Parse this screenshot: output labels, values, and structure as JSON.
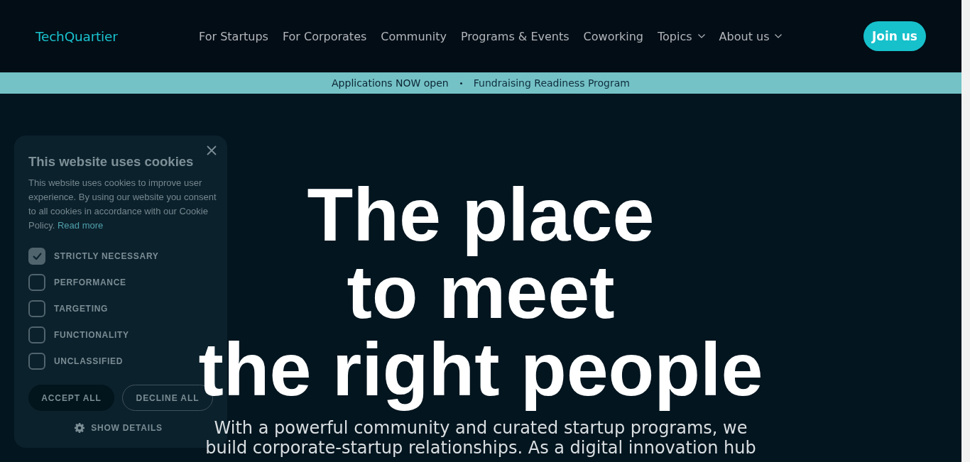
{
  "header": {
    "logo": "TechQuartier",
    "nav": [
      {
        "label": "For Startups",
        "dropdown": false
      },
      {
        "label": "For Corporates",
        "dropdown": false
      },
      {
        "label": "Community",
        "dropdown": false
      },
      {
        "label": "Programs & Events",
        "dropdown": false
      },
      {
        "label": "Coworking",
        "dropdown": false
      },
      {
        "label": "Topics",
        "dropdown": true
      },
      {
        "label": "About us",
        "dropdown": true
      }
    ],
    "cta": "Join us"
  },
  "announcement": {
    "label": "Applications NOW open",
    "link": "Fundraising Readiness Program"
  },
  "hero": {
    "title_lines": [
      "The place",
      "to meet",
      "the right people"
    ],
    "subtitle": "With a powerful community and curated startup programs, we build corporate-startup relationships. As a digital innovation hub"
  },
  "cookie_banner": {
    "title": "This website uses cookies",
    "text": "This website uses cookies to improve user experience. By using our website you consent to all cookies in accordance with our Cookie Policy.",
    "link": "Read more",
    "categories": [
      {
        "label": "STRICTLY NECESSARY",
        "checked": true
      },
      {
        "label": "PERFORMANCE",
        "checked": false
      },
      {
        "label": "TARGETING",
        "checked": false
      },
      {
        "label": "FUNCTIONALITY",
        "checked": false
      },
      {
        "label": "UNCLASSIFIED",
        "checked": false
      }
    ],
    "buttons": [
      {
        "label": "ACCEPT ALL",
        "kind": "primary"
      },
      {
        "label": "DECLINE ALL",
        "kind": "outline"
      }
    ],
    "details": "SHOW DETAILS"
  }
}
